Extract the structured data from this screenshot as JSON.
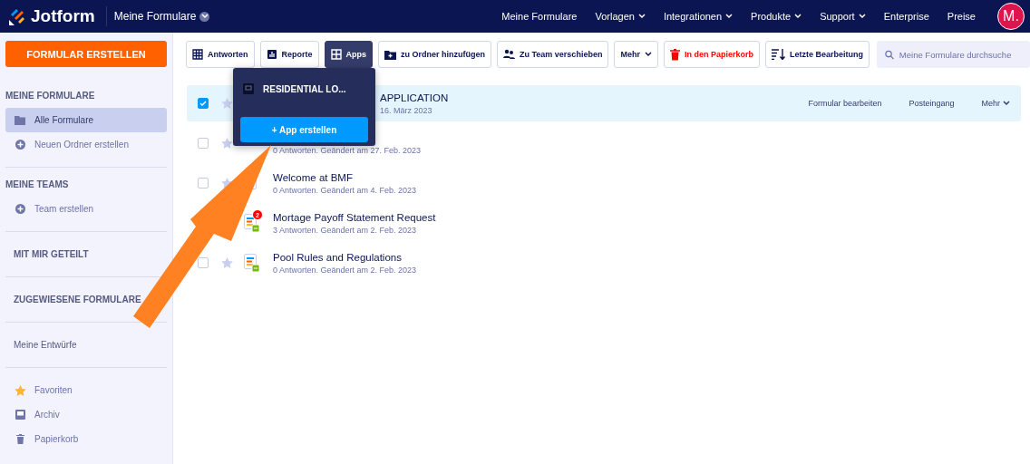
{
  "header": {
    "brand": "Jotform",
    "workspace": "Meine Formulare",
    "nav": [
      {
        "label": "Meine Formulare",
        "dropdown": false
      },
      {
        "label": "Vorlagen",
        "dropdown": true
      },
      {
        "label": "Integrationen",
        "dropdown": true
      },
      {
        "label": "Produkte",
        "dropdown": true
      },
      {
        "label": "Support",
        "dropdown": true
      },
      {
        "label": "Enterprise",
        "dropdown": false
      },
      {
        "label": "Preise",
        "dropdown": false
      }
    ],
    "avatar": "M."
  },
  "create_button": "FORMULAR ERSTELLEN",
  "sidebar": {
    "sections": [
      {
        "heading": "MEINE FORMULARE",
        "items": [
          {
            "label": "Alle Formulare",
            "kind": "folder",
            "selected": true
          },
          {
            "label": "Neuen Ordner erstellen",
            "kind": "add",
            "selected": false
          }
        ]
      },
      {
        "heading": "MEINE TEAMS",
        "items": [
          {
            "label": "Team erstellen",
            "kind": "add",
            "selected": false
          }
        ]
      },
      {
        "link": "MIT MIR GETEILT",
        "bold": true
      },
      {
        "link": "ZUGEWIESENE FORMULARE",
        "bold": true
      },
      {
        "link": "Meine Entwürfe",
        "bold": false
      },
      {
        "items": [
          {
            "label": "Favoriten",
            "kind": "star",
            "selected": false
          },
          {
            "label": "Archiv",
            "kind": "archive",
            "selected": false
          },
          {
            "label": "Papierkorb",
            "kind": "trash",
            "selected": false
          }
        ]
      }
    ]
  },
  "toolbar": [
    {
      "label": "Antworten",
      "kind": "grid",
      "selected": false
    },
    {
      "label": "Reporte",
      "kind": "chart",
      "selected": false
    },
    {
      "label": "Apps",
      "kind": "apps",
      "selected": true
    },
    {
      "label": "zu Ordner hinzufügen",
      "kind": "folder",
      "selected": false
    },
    {
      "label": "Zu Team verschieben",
      "kind": "team",
      "selected": false
    },
    {
      "label": "Mehr",
      "kind": "dropdown",
      "selected": false
    },
    {
      "label": "In den Papierkorb",
      "kind": "trash",
      "selected": false
    },
    {
      "label": "Letzte Bearbeitung",
      "kind": "sort",
      "selected": false
    }
  ],
  "search": {
    "placeholder": "Meine Formulare durchsuche"
  },
  "forms": [
    {
      "title": "APPLICATION",
      "subtitle": "16. März 2023",
      "checked": true,
      "starred": false,
      "actions": [
        "Formular bearbeiten",
        "Posteingang",
        "Mehr"
      ]
    },
    {
      "subtitle": "0 Antworten. Geändert am 27. Feb. 2023",
      "checked": false,
      "starred": false
    },
    {
      "title": "Welcome at BMF",
      "subtitle": "0 Antworten. Geändert am 4. Feb. 2023",
      "checked": false,
      "starred": false,
      "kind": "plain"
    },
    {
      "title": "Mortage Payoff Statement Request",
      "subtitle": "3 Antworten. Geändert am 2. Feb. 2023",
      "kind": "submissions",
      "badge": "2"
    },
    {
      "title": "Pool Rules and Regulations",
      "subtitle": "0 Antworten. Geändert am 2. Feb. 2023",
      "checked": false,
      "starred": false,
      "kind": "submissions"
    }
  ],
  "apps_popup": {
    "open": true,
    "app": "RESIDENTIAL LO...",
    "button": "+ App erstellen"
  }
}
